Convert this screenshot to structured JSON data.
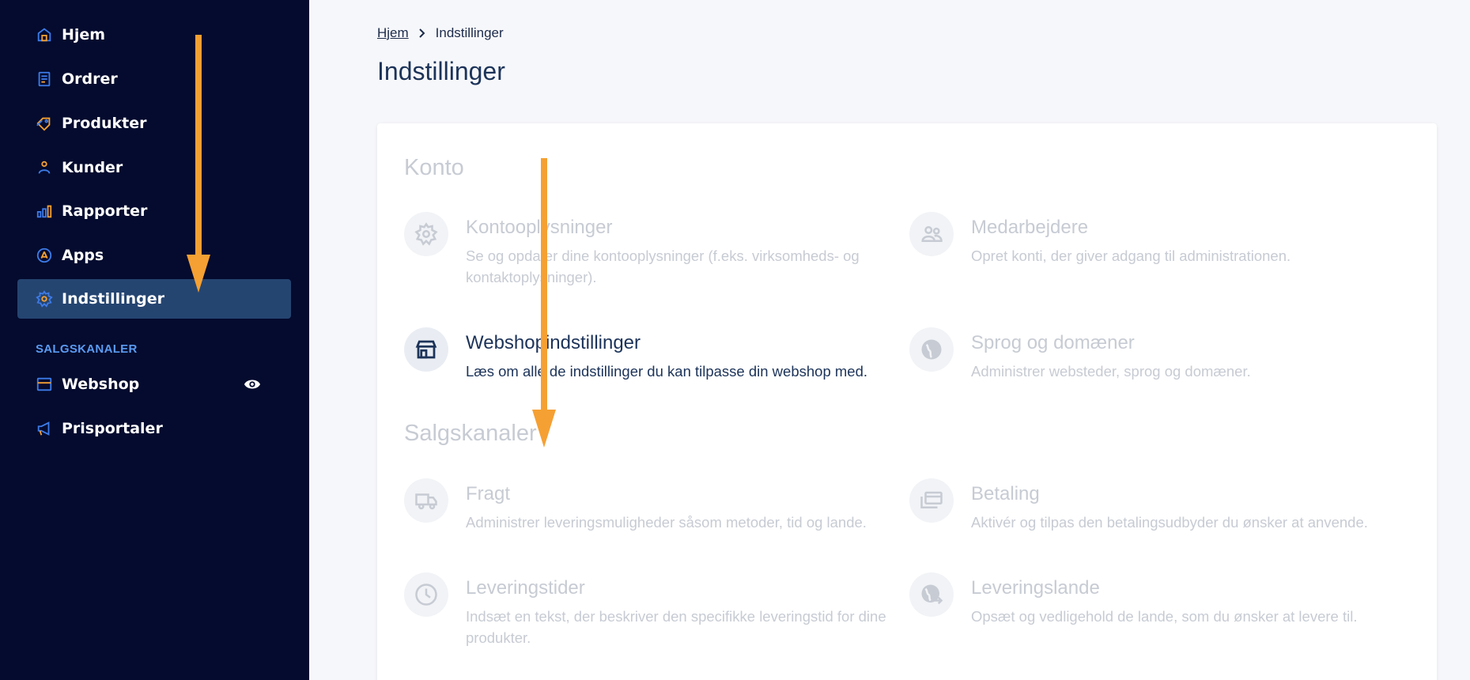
{
  "sidebar": {
    "items": [
      {
        "label": "Hjem",
        "icon": "home-icon"
      },
      {
        "label": "Ordrer",
        "icon": "receipt-icon"
      },
      {
        "label": "Produkter",
        "icon": "tag-icon"
      },
      {
        "label": "Kunder",
        "icon": "user-icon"
      },
      {
        "label": "Rapporter",
        "icon": "bar-chart-icon"
      },
      {
        "label": "Apps",
        "icon": "apps-icon"
      },
      {
        "label": "Indstillinger",
        "icon": "gear-icon",
        "active": true
      }
    ],
    "section_title": "SALGSKANALER",
    "channels": [
      {
        "label": "Webshop",
        "icon": "storefront-icon",
        "trailing_icon": "eye-icon"
      },
      {
        "label": "Prisportaler",
        "icon": "megaphone-icon"
      }
    ]
  },
  "breadcrumb": {
    "home": "Hjem",
    "current": "Indstillinger"
  },
  "page_title": "Indstillinger",
  "groups": {
    "konto": {
      "title": "Konto",
      "items": [
        {
          "title": "Kontooplysninger",
          "desc": "Se og opdater dine kontooplysninger (f.eks. virksomheds- og kontaktoplysninger).",
          "icon": "gear-icon"
        },
        {
          "title": "Medarbejdere",
          "desc": "Opret konti, der giver adgang til administrationen.",
          "icon": "people-icon"
        },
        {
          "title": "Webshopindstillinger",
          "desc": "Læs om alle de indstillinger du kan tilpasse din webshop med.",
          "icon": "storefront-icon"
        },
        {
          "title": "Sprog og domæner",
          "desc": "Administrer websteder, sprog og domæner.",
          "icon": "globe-icon"
        }
      ]
    },
    "salgskanaler": {
      "title": "Salgskanaler",
      "items": [
        {
          "title": "Fragt",
          "desc": "Administrer leveringsmuligheder såsom metoder, tid og lande.",
          "icon": "truck-icon"
        },
        {
          "title": "Betaling",
          "desc": "Aktivér og tilpas den betalingsudbyder du ønsker at anvende.",
          "icon": "cards-icon"
        },
        {
          "title": "Leveringstider",
          "desc": "Indsæt en tekst, der beskriver den specifikke leveringstid for dine produkter.",
          "icon": "clock-icon"
        },
        {
          "title": "Leveringslande",
          "desc": "Opsæt og vedligehold de lande, som du ønsker at levere til.",
          "icon": "globe-arrow-icon"
        }
      ]
    }
  },
  "colors": {
    "sidebar_bg": "#040b2e",
    "active_bg": "#254571",
    "accent_blue": "#3d7be8",
    "accent_orange": "#f5a033",
    "title_dark": "#1c3359",
    "muted": "#c7cbd3"
  }
}
